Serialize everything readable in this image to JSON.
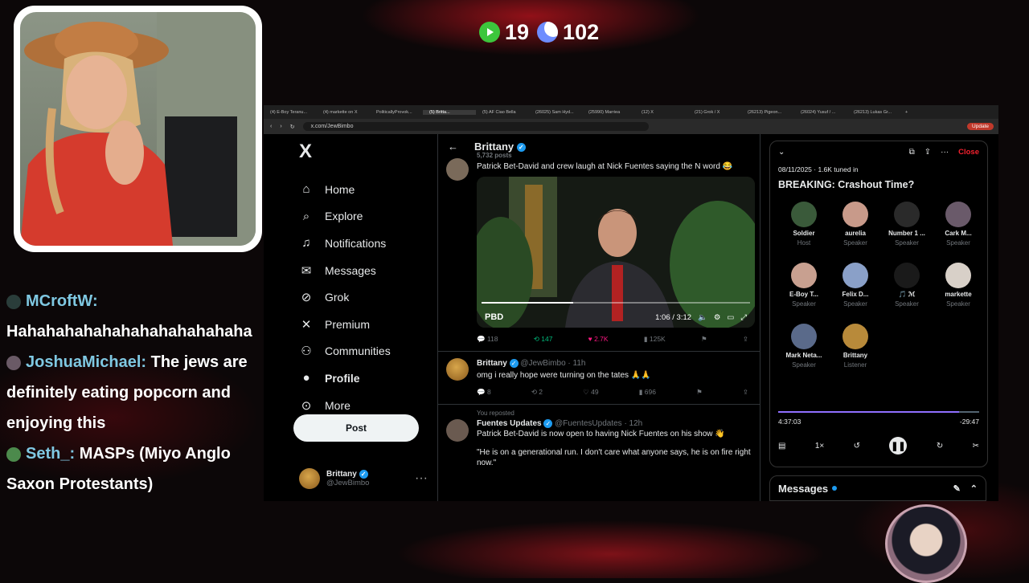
{
  "stats": {
    "play_count": "19",
    "moon_count": "102"
  },
  "chat": [
    {
      "user": "MCroftW:",
      "text": "Hahahahahahahahahahahahaha",
      "badge_color": "#2a3d3a"
    },
    {
      "user": "JoshuaMichael:",
      "text": "The jews are definitely eating popcorn and enjoying this",
      "badge_color": "#6a5a66"
    },
    {
      "user": "Seth_:",
      "text": "MASPs (Miyo Anglo Saxon Protestants)",
      "badge_color": "#4c8a4c"
    }
  ],
  "browser": {
    "tabs": [
      "(4) E-Boy Teranu...",
      "(4) markette on X",
      "PoliticallyProvok...",
      "(5) Britta...",
      "(5) AF Ciao Bella",
      "(26025) Sam Hyd...",
      "(25990) Marriea",
      "(12) X",
      "(21) Grok / X",
      "(26213) Pigeon...",
      "(26024) Yusuf / ...",
      "(26213) Lukas Gr..."
    ],
    "url": "x.com/JewBimbo",
    "update_label": "Update"
  },
  "nav": {
    "logo": "X",
    "items": [
      "Home",
      "Explore",
      "Notifications",
      "Messages",
      "Grok",
      "Premium",
      "Communities",
      "Profile",
      "More"
    ],
    "post_label": "Post",
    "profile_name": "Brittany",
    "profile_handle": "@JewBimbo"
  },
  "timeline": {
    "header_name": "Brittany",
    "post_count": "5,732 posts",
    "tweets": [
      {
        "text": "Patrick Bet-David and crew laugh at Nick Fuentes saying the N word 😂",
        "video_time": "1:06 / 3:12",
        "video_progress": 0.34,
        "video_logo": "PBD",
        "replies": "118",
        "reposts": "147",
        "likes": "2.7K",
        "views": "125K"
      },
      {
        "name": "Brittany",
        "handle": "@JewBimbo · 11h",
        "text": "omg i really hope were turning on the tates 🙏🙏",
        "replies": "8",
        "reposts": "2",
        "likes": "49",
        "views": "696"
      },
      {
        "context": "You reposted",
        "name": "Fuentes Updates",
        "handle": "@FuentesUpdates · 12h",
        "text": "Patrick Bet-David is now open to having Nick Fuentes on his show 👋",
        "quote": "\"He is on a generational run. I don't care what anyone says, he is on fire right now.\""
      }
    ]
  },
  "space": {
    "close_label": "Close",
    "meta": "08/11/2025 · 1.6K tuned in",
    "title": "BREAKING: Crashout Time?",
    "members": [
      {
        "name": "Soldier",
        "role": "Host",
        "color": "#3a5a3a"
      },
      {
        "name": "aurelia",
        "role": "Speaker",
        "color": "#c89a8a"
      },
      {
        "name": "Number 1 ...",
        "role": "Speaker",
        "color": "#2a2a2a"
      },
      {
        "name": "Cark M...",
        "role": "Speaker",
        "color": "#6a5a6a"
      },
      {
        "name": "E-Boy T...",
        "role": "Speaker",
        "color": "#c8a090"
      },
      {
        "name": "Felix D...",
        "role": "Speaker",
        "color": "#8aa0c8"
      },
      {
        "name": "🎵 ℳ",
        "role": "Speaker",
        "color": "#1a1a1a"
      },
      {
        "name": "markette",
        "role": "Speaker",
        "color": "#d8d0c8"
      },
      {
        "name": "Mark Neta...",
        "role": "Speaker",
        "color": "#5a6a8a"
      },
      {
        "name": "Brittany",
        "role": "Listener",
        "color": "#b88a3a"
      }
    ],
    "elapsed": "4:37:03",
    "remaining": "-29:47",
    "progress": 0.9,
    "speed": "1×",
    "messages_label": "Messages"
  }
}
